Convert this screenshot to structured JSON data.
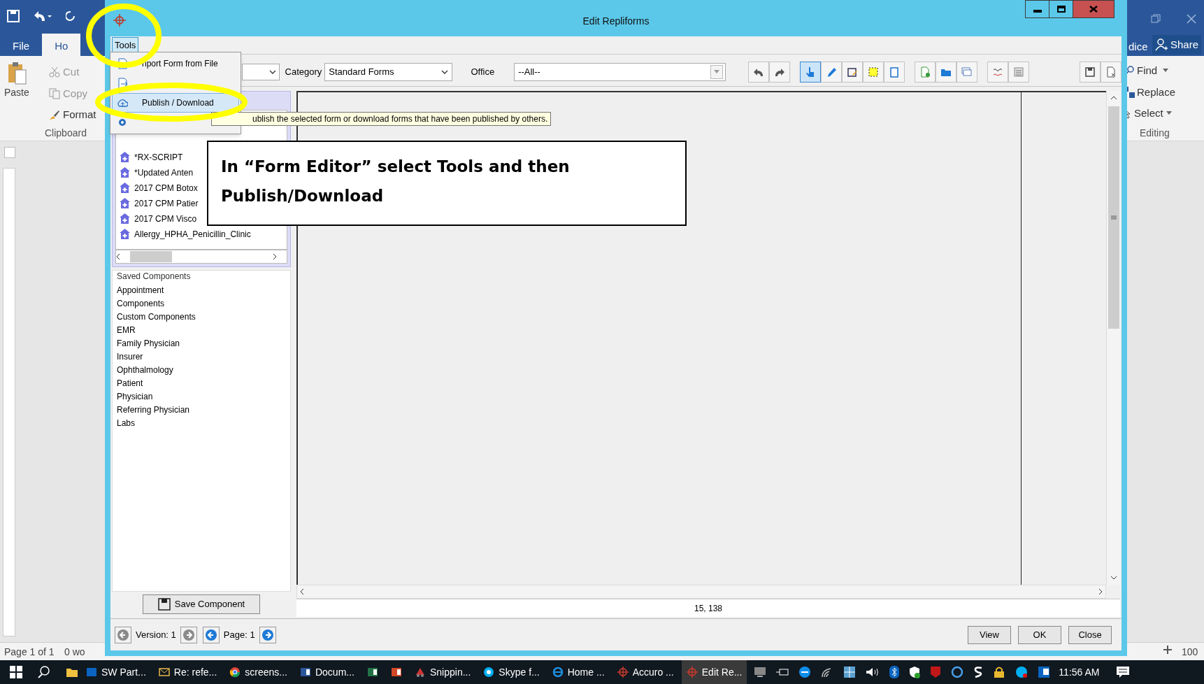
{
  "word": {
    "tabs": [
      {
        "label": "File",
        "selected": false
      },
      {
        "label": "Ho",
        "selected": true
      }
    ],
    "clipboard": {
      "paste": "Paste",
      "cut": "Cut",
      "copy": "Copy",
      "format": "Format",
      "group": "Clipboard"
    },
    "editing": {
      "tab": "dice",
      "share": "Share",
      "find": "Find",
      "replace": "Replace",
      "select": "Select",
      "group": "Editing"
    },
    "status": {
      "page": "Page 1 of 1",
      "words": "0 wo",
      "zoom": "100"
    }
  },
  "dialog": {
    "title": "Edit Repliforms",
    "menu": [
      {
        "label": "Tools",
        "selected": true
      }
    ],
    "tools_menu": [
      {
        "kind": "import",
        "label": "nport Form from File",
        "selected": false
      },
      {
        "kind": "export",
        "selected": false
      },
      {
        "kind": "publish",
        "label": "Publish / Download",
        "selected": true
      },
      {
        "kind": "configure",
        "selected": false
      }
    ],
    "tooltip": "ublish the selected form or download forms that have been published by others.",
    "toolbar": {
      "category_label": "Category",
      "category": "Standard Forms",
      "office_label": "Office",
      "office": "--All--",
      "tool_groups": [
        [
          {
            "kind": "undo",
            "selected": false
          },
          {
            "kind": "redo",
            "selected": false
          }
        ],
        [
          {
            "kind": "pointer",
            "selected": true
          },
          {
            "kind": "pen",
            "selected": false
          },
          {
            "kind": "edit-box",
            "selected": false
          },
          {
            "kind": "select-area",
            "selected": false
          },
          {
            "kind": "rectangle",
            "selected": false
          }
        ],
        [
          {
            "kind": "new-page",
            "selected": false
          },
          {
            "kind": "folder",
            "selected": false
          },
          {
            "kind": "pages",
            "selected": false
          }
        ],
        [
          {
            "kind": "spellcheck",
            "selected": false
          },
          {
            "kind": "properties",
            "selected": false
          }
        ],
        [
          {
            "kind": "save",
            "selected": false
          },
          {
            "kind": "close-document",
            "selected": false
          }
        ]
      ]
    },
    "forms": [
      "*RX-SCRIPT",
      "*Updated Anten",
      "2017 CPM Botox",
      "2017 CPM Patier",
      "2017 CPM Visco",
      "Allergy_HPHA_Penicillin_Clinic"
    ],
    "saved_components": {
      "title": "Saved Components",
      "items": [
        "Appointment",
        "Components",
        "Custom Components",
        "EMR",
        "Family Physician",
        "Insurer",
        "Ophthalmology",
        "Patient",
        "Physician",
        "Referring Physician",
        "Labs"
      ]
    },
    "save_button": "Save Component",
    "coordinates": "15, 138",
    "footer": {
      "version": "Version: 1",
      "page": "Page: 1",
      "buttons": [
        "View",
        "OK",
        "Close"
      ]
    }
  },
  "callout": "In “Form Editor” select Tools and then Publish/Download",
  "taskbar": {
    "apps": [
      {
        "kind": "outlook",
        "label": "SW Part...",
        "active": false
      },
      {
        "kind": "mail",
        "label": "Re: refe...",
        "active": false
      },
      {
        "kind": "chrome",
        "label": "screens...",
        "active": false
      },
      {
        "kind": "word",
        "label": "Docum...",
        "active": false
      },
      {
        "kind": "excel",
        "active": false
      },
      {
        "kind": "powerpoint",
        "active": false
      },
      {
        "kind": "snipping",
        "label": "Snippin...",
        "active": false
      },
      {
        "kind": "skype",
        "label": "Skype f...",
        "active": false
      },
      {
        "kind": "browser",
        "label": "Home ...",
        "active": false
      },
      {
        "kind": "target",
        "label": "Accuro ...",
        "active": false
      },
      {
        "kind": "target",
        "label": "Edit Re...",
        "active": true
      }
    ],
    "time": "11:56 AM"
  }
}
